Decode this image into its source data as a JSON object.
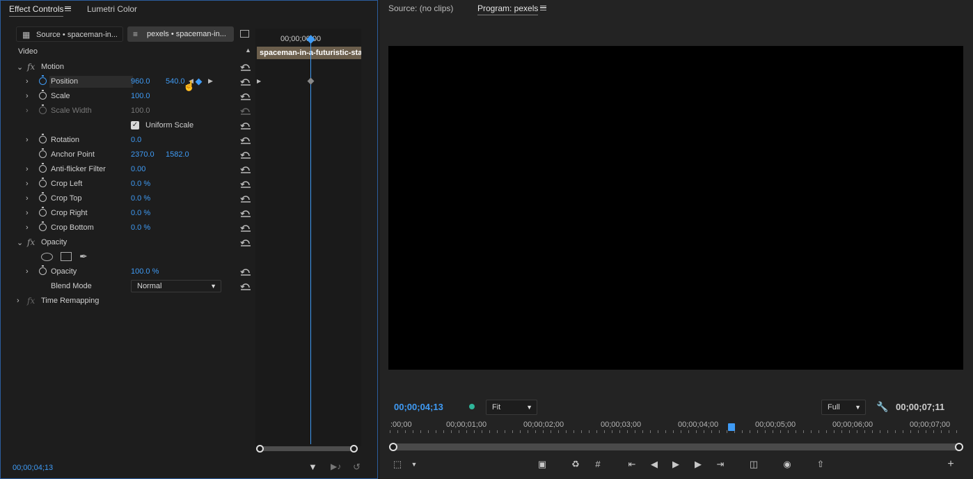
{
  "effect_controls": {
    "tabs": [
      "Effect Controls",
      "Lumetri Color"
    ],
    "source_clip": "Source • spaceman-in...",
    "sequence_clip": "pexels • spaceman-in...",
    "timecode_ruler": "00;00;00;00",
    "clip_bar_label": "spaceman-in-a-futuristic-statio",
    "video_header": "Video",
    "motion": {
      "name": "Motion",
      "position_label": "Position",
      "position_x": "960.0",
      "position_y": "540.0",
      "scale_label": "Scale",
      "scale": "100.0",
      "scale_width_label": "Scale Width",
      "scale_width": "100.0",
      "uniform_scale_label": "Uniform Scale",
      "rotation_label": "Rotation",
      "rotation": "0.0",
      "anchor_label": "Anchor Point",
      "anchor_x": "2370.0",
      "anchor_y": "1582.0",
      "antiflicker_label": "Anti-flicker Filter",
      "antiflicker": "0.00",
      "crop_left_label": "Crop Left",
      "crop_left": "0.0 %",
      "crop_top_label": "Crop Top",
      "crop_top": "0.0 %",
      "crop_right_label": "Crop Right",
      "crop_right": "0.0 %",
      "crop_bottom_label": "Crop Bottom",
      "crop_bottom": "0.0 %"
    },
    "opacity": {
      "name": "Opacity",
      "opacity_label": "Opacity",
      "opacity": "100.0 %",
      "blend_label": "Blend Mode",
      "blend": "Normal"
    },
    "time_remap": "Time Remapping",
    "current_time": "00;00;04;13"
  },
  "source_tab": "Source: (no clips)",
  "program": {
    "tab": "Program: pexels",
    "current_time": "00;00;04;13",
    "fit": "Fit",
    "quality": "Full",
    "duration": "00;00;07;11",
    "ruler": [
      ":00;00",
      "00;00;01;00",
      "00;00;02;00",
      "00;00;03;00",
      "00;00;04;00",
      "00;00;05;00",
      "00;00;06;00",
      "00;00;07;00"
    ]
  },
  "colors": {
    "accent": "#3f9bf5",
    "panel_border": "#2c5d9e"
  }
}
